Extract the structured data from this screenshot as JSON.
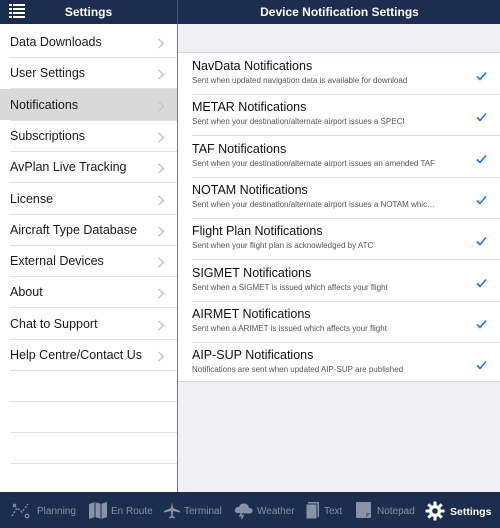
{
  "header": {
    "left_title": "Settings",
    "right_title": "Device Notification Settings",
    "menu_icon": "list-menu-icon"
  },
  "sidebar": {
    "items": [
      {
        "label": "Data Downloads"
      },
      {
        "label": "User Settings"
      },
      {
        "label": "Notifications",
        "selected": true
      },
      {
        "label": "Subscriptions"
      },
      {
        "label": "AvPlan Live Tracking"
      },
      {
        "label": "License"
      },
      {
        "label": "Aircraft Type Database"
      },
      {
        "label": "External Devices"
      },
      {
        "label": "About"
      },
      {
        "label": "Chat to Support"
      },
      {
        "label": "Help Centre/Contact Us"
      }
    ]
  },
  "notifications": [
    {
      "title": "NavData Notifications",
      "subtitle": "Sent when updated navigation data is available for download",
      "checked": true
    },
    {
      "title": "METAR Notifications",
      "subtitle": "Sent when your destination/alternate airport issues a SPECI",
      "checked": true
    },
    {
      "title": "TAF Notifications",
      "subtitle": "Sent when your destination/alternate airport issues an amended TAF",
      "checked": true
    },
    {
      "title": "NOTAM Notifications",
      "subtitle": "Sent when your destination/alternate airport issues a NOTAM whic…",
      "checked": true
    },
    {
      "title": "Flight Plan Notifications",
      "subtitle": "Sent when your flight plan is acknowledged by ATC",
      "checked": true
    },
    {
      "title": "SIGMET Notifications",
      "subtitle": "Sent when a SIGMET is issued which affects your flight",
      "checked": true
    },
    {
      "title": "AIRMET Notifications",
      "subtitle": "Sent when a ARIMET is issued which affects your flight",
      "checked": true
    },
    {
      "title": "AIP-SUP Notifications",
      "subtitle": "Notifications are sent when updated AIP-SUP are published",
      "checked": true
    }
  ],
  "tabbar": {
    "tabs": [
      {
        "label": "Planning",
        "icon": "planning-icon",
        "active": false
      },
      {
        "label": "En Route",
        "icon": "map-icon",
        "active": false
      },
      {
        "label": "Terminal",
        "icon": "airplane-icon",
        "active": false
      },
      {
        "label": "Weather",
        "icon": "weather-icon",
        "active": false
      },
      {
        "label": "Text",
        "icon": "document-icon",
        "active": false
      },
      {
        "label": "Notepad",
        "icon": "notepad-icon",
        "active": false
      },
      {
        "label": "Settings",
        "icon": "gear-icon",
        "active": true
      }
    ]
  },
  "colors": {
    "header_bg": "#1c2d4d",
    "accent": "#1a73e8",
    "selected_bg": "#d9d9d9"
  }
}
